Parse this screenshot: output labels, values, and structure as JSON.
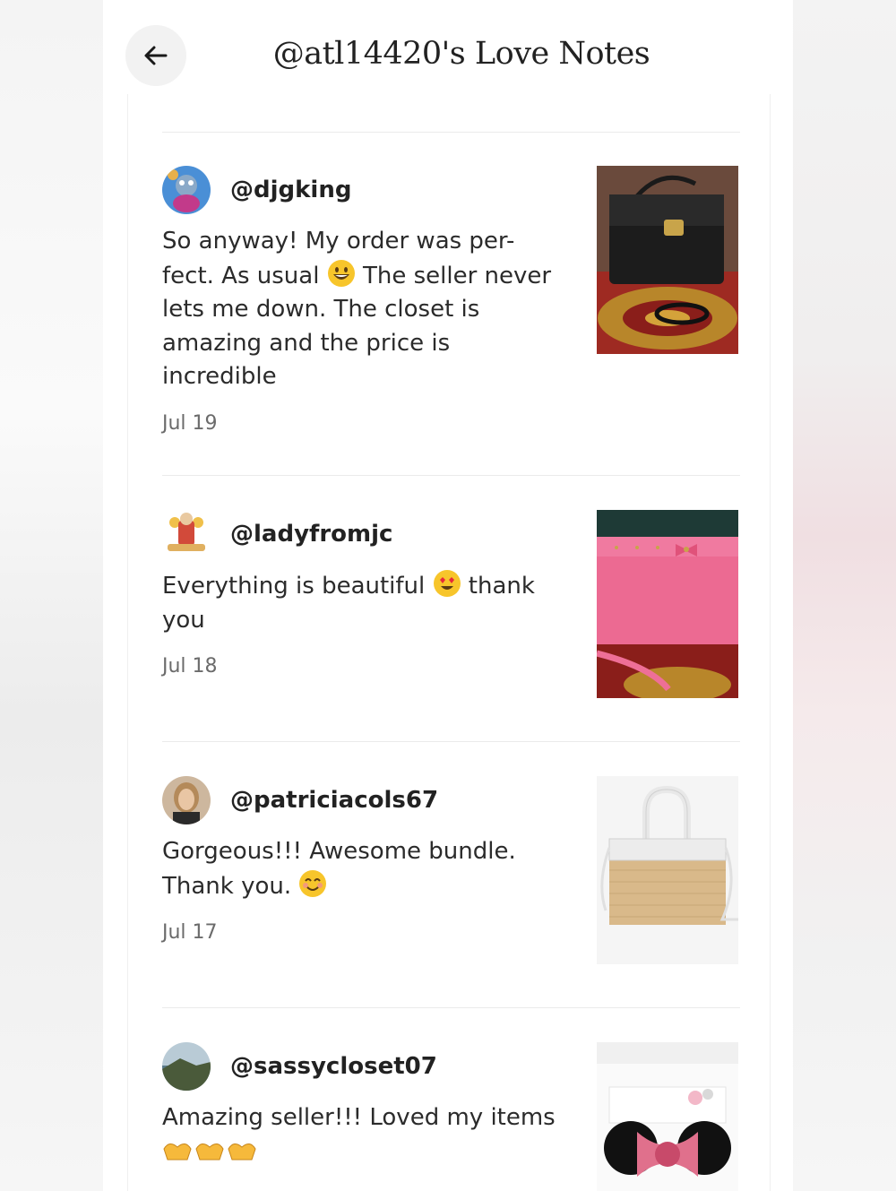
{
  "header": {
    "title": "@atl14420's Love Notes",
    "back_icon": "arrow-left-icon"
  },
  "notes": [
    {
      "username": "@djgking",
      "message_lines": [
        "So anyway! My order was per-",
        "fect. As usual",
        "The seller never",
        "lets me down. The closet is",
        "amazing and the price is",
        "incredible"
      ],
      "emoji": "grinning-face",
      "date": "Jul 19",
      "thumb": "black-croc-handbag"
    },
    {
      "username": "@ladyfromjc",
      "message_lines": [
        "Everything is beautiful",
        "thank",
        "you"
      ],
      "emoji": "heart-eyes-face",
      "date": "Jul 18",
      "thumb": "pink-bow-handbag"
    },
    {
      "username": "@patriciacols67",
      "message_lines": [
        "Gorgeous!!! Awesome bundle.",
        "Thank you."
      ],
      "emoji": "smiling-face",
      "date": "Jul 17",
      "thumb": "straw-satchel-handbag"
    },
    {
      "username": "@sassycloset07",
      "message_lines": [
        "Amazing seller!!! Loved my items"
      ],
      "emoji": "heart-hands",
      "date": "",
      "thumb": "mouse-ears-headband"
    }
  ]
}
